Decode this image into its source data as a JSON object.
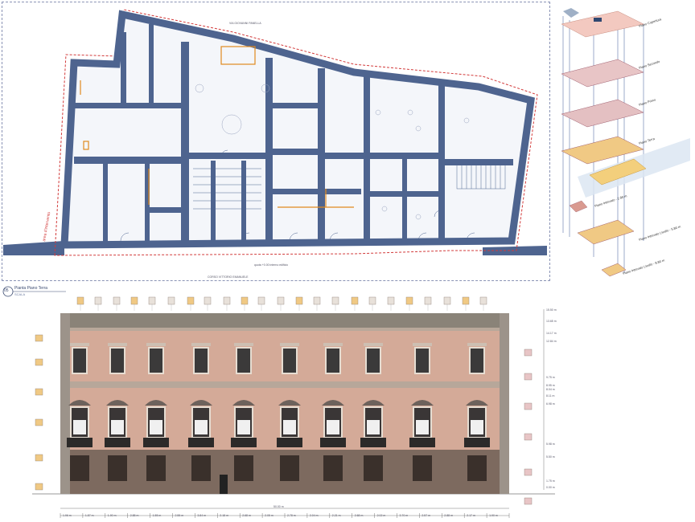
{
  "plan": {
    "top_street_label": "VIA GIOVANNI PANELLA",
    "bottom_street_label": "CORSO VITTORIO EMANUELE",
    "left_boundary_label": "area d'intervento",
    "legend_note": "quota +0.00 interno edificio"
  },
  "section_header": {
    "number": "05",
    "title": "Pianta Piano Terra",
    "subtitle": "SCALA"
  },
  "axonometric": {
    "levels": [
      "Piano Copertura",
      "Piano Secondo",
      "Piano Primo",
      "Piano Terra",
      "Piano Interrato - 2.80 m",
      "Piano Interrato Livello - 5.80 m",
      "Piano Interrato Livello - 8.80 m"
    ]
  },
  "facade": {
    "right_elevations": [
      "15.50 m",
      "13.65 m",
      "14.17 m",
      "12.84 m",
      "9.75 m",
      "8.95 m",
      "8.04 m",
      "8.11 m",
      "6.98 m",
      "5.98 m",
      "5.50 m",
      "1.75 m",
      "0.00 m"
    ],
    "bottom_total": "50.00 m",
    "bottom_dims": [
      "1.96 m",
      "1.87 m",
      "1.90 m",
      "2.88 m",
      "1.55 m",
      "2.55 m",
      "3.84 m",
      "2.18 m",
      "2.68 m",
      "2.05 m",
      "2.78 m",
      "2.04 m",
      "2.21 m",
      "2.68 m",
      "2.02 m",
      "3.70 m",
      "2.57 m",
      "2.88 m",
      "2.17 m",
      "1.90 m"
    ]
  },
  "colors": {
    "wall": "#4e648f",
    "boundary": "#d23a3a",
    "accent": "#e08a1e",
    "plaster": "#d4aa98"
  }
}
